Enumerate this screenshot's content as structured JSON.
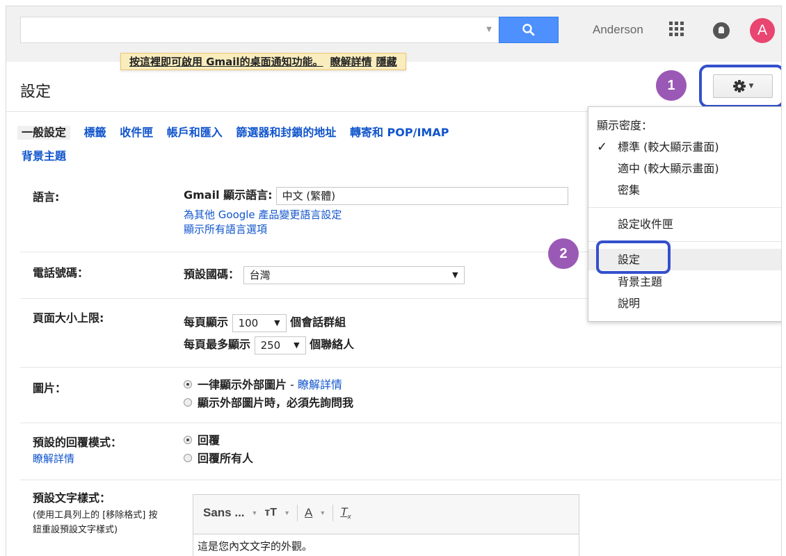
{
  "topbar": {
    "search_placeholder": "",
    "user_name": "Anderson",
    "avatar_letter": "A",
    "avatar_color": "#e94571"
  },
  "notice": {
    "text": "按這裡即可啟用 Gmail的桌面通知功能。",
    "learn_more": "瞭解詳情",
    "hide": "隱藏"
  },
  "settings": {
    "title": "設定"
  },
  "annotations": {
    "step1": "1",
    "step2": "2",
    "badge_color": "#9b59b6",
    "box_color": "#3450cc"
  },
  "tabs": [
    {
      "label": "一般設定",
      "active": true
    },
    {
      "label": "標籤"
    },
    {
      "label": "收件匣"
    },
    {
      "label": "帳戶和匯入"
    },
    {
      "label": "篩選器和封鎖的地址"
    },
    {
      "label": "轉寄和 POP/IMAP"
    },
    {
      "label": "背景主題"
    }
  ],
  "rows": {
    "language": {
      "label": "語言:",
      "field_label": "Gmail 顯示語言:",
      "value": "中文 (繁體)",
      "link1": "為其他 Google 產品變更語言設定",
      "link2": "顯示所有語言選項"
    },
    "phone": {
      "label": "電話號碼：",
      "field_label": "預設國碼：",
      "value": "台灣",
      "arrow": "▼"
    },
    "page_size": {
      "label": "頁面大小上限:",
      "line1_prefix": "每頁顯示",
      "line1_value": "100",
      "line1_suffix": "個會話群組",
      "line2_prefix": "每頁最多顯示",
      "line2_value": "250",
      "line2_suffix": "個聯絡人",
      "arrow": "▼"
    },
    "images": {
      "label": "圖片：",
      "option1": "一律顯示外部圖片",
      "option1_dash": " - ",
      "option1_link": "瞭解詳情",
      "option2": "顯示外部圖片時，必須先詢問我"
    },
    "reply": {
      "label": "預設的回覆模式：",
      "link": "瞭解詳情",
      "option1": "回覆",
      "option2": "回覆所有人"
    },
    "text_style": {
      "label": "預設文字樣式：",
      "note": "(使用工具列上的 [移除格式] 按鈕重設預設文字樣式)",
      "font": "Sans ...",
      "preview": "這是您內文文字的外觀。"
    }
  },
  "menu": {
    "header": "顯示密度：",
    "density": [
      {
        "label": "標準 (較大顯示畫面)",
        "checked": true
      },
      {
        "label": "適中 (較大顯示畫面)"
      },
      {
        "label": "密集"
      }
    ],
    "check": "✓",
    "items": [
      "設定收件匣",
      "設定",
      "背景主題",
      "說明"
    ]
  }
}
